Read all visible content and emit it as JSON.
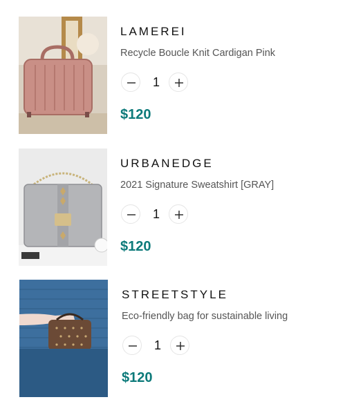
{
  "products": [
    {
      "brand": "LAMEREI",
      "title": "Recycle Boucle Knit Cardigan Pink",
      "quantity": "1",
      "price": "$120",
      "image_icon": "pink-suitcase-bag-photo"
    },
    {
      "brand": "URBANEDGE",
      "title": "2021 Signature Sweatshirt [GRAY]",
      "quantity": "1",
      "price": "$120",
      "image_icon": "gray-studded-handbag-photo"
    },
    {
      "brand": "STREETSTYLE",
      "title": "Eco-friendly bag for sustainable living",
      "quantity": "1",
      "price": "$120",
      "image_icon": "brown-monogram-bag-photo"
    }
  ],
  "colors": {
    "price": "#0d7a7a",
    "brand": "#111111",
    "title": "#555555"
  }
}
